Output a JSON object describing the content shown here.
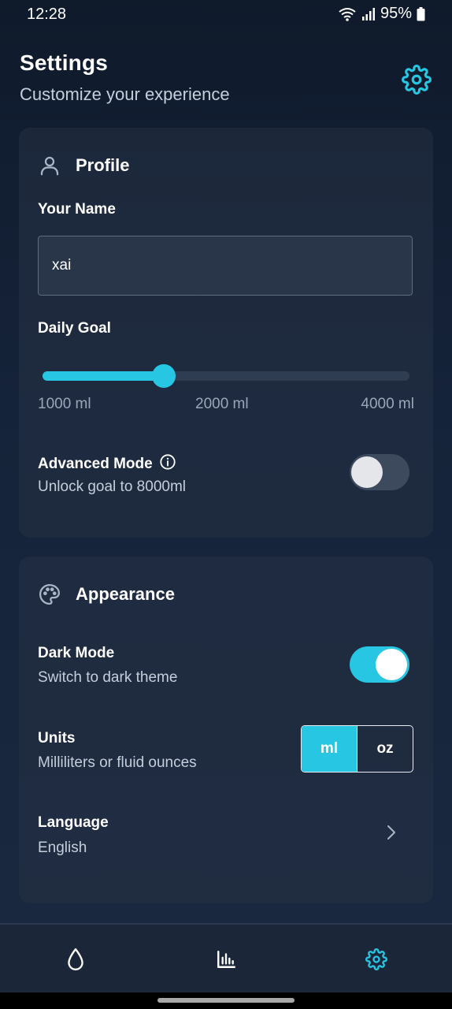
{
  "status_bar": {
    "time": "12:28",
    "battery": "95%",
    "icons": [
      "wifi-icon",
      "signal-icon",
      "battery-icon"
    ]
  },
  "header": {
    "title": "Settings",
    "subtitle": "Customize your experience",
    "icon": "gear-icon"
  },
  "profile": {
    "section_title": "Profile",
    "icon": "user-icon",
    "name_label": "Your Name",
    "name_value": "xai",
    "daily_goal_label": "Daily Goal",
    "slider": {
      "min_ml": 1000,
      "max_ml": 4000,
      "value_fraction": 0.33
    },
    "ticks": [
      "1000 ml",
      "2000 ml",
      "4000 ml"
    ],
    "advanced_mode": {
      "label": "Advanced Mode",
      "description": "Unlock goal to 8000ml",
      "enabled": false,
      "icon": "info-icon"
    }
  },
  "appearance": {
    "section_title": "Appearance",
    "icon": "palette-icon",
    "dark_mode": {
      "label": "Dark Mode",
      "description": "Switch to dark theme",
      "enabled": true
    },
    "units": {
      "label": "Units",
      "description": "Milliliters or fluid ounces",
      "options": [
        "ml",
        "oz"
      ],
      "selected": "ml"
    },
    "language": {
      "label": "Language",
      "value": "English",
      "icon": "chevron-right-icon"
    }
  },
  "bottom_nav": {
    "items": [
      {
        "icon": "water-drop-icon",
        "active": false
      },
      {
        "icon": "bar-chart-icon",
        "active": false
      },
      {
        "icon": "gear-icon",
        "active": true
      }
    ]
  },
  "colors": {
    "accent": "#27c6e3",
    "background": "#15233a",
    "card": "#263244",
    "text_secondary": "#c5cedb"
  }
}
